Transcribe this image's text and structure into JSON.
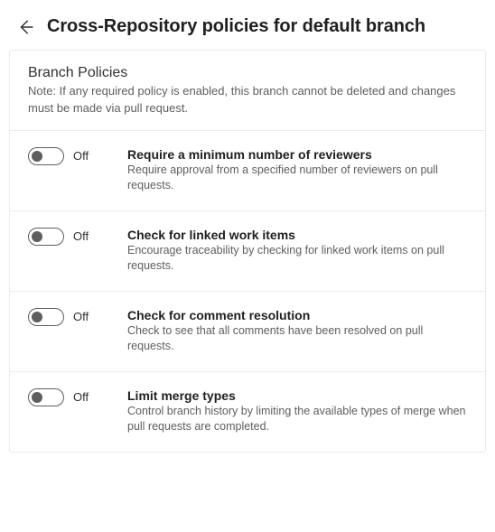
{
  "header": {
    "title": "Cross-Repository policies for default branch"
  },
  "card": {
    "title": "Branch Policies",
    "note": "Note: If any required policy is enabled, this branch cannot be deleted and changes must be made via pull request."
  },
  "toggle_off_label": "Off",
  "policies": [
    {
      "title": "Require a minimum number of reviewers",
      "desc": "Require approval from a specified number of reviewers on pull requests."
    },
    {
      "title": "Check for linked work items",
      "desc": "Encourage traceability by checking for linked work items on pull requests."
    },
    {
      "title": "Check for comment resolution",
      "desc": "Check to see that all comments have been resolved on pull requests."
    },
    {
      "title": "Limit merge types",
      "desc": "Control branch history by limiting the available types of merge when pull requests are completed."
    }
  ]
}
